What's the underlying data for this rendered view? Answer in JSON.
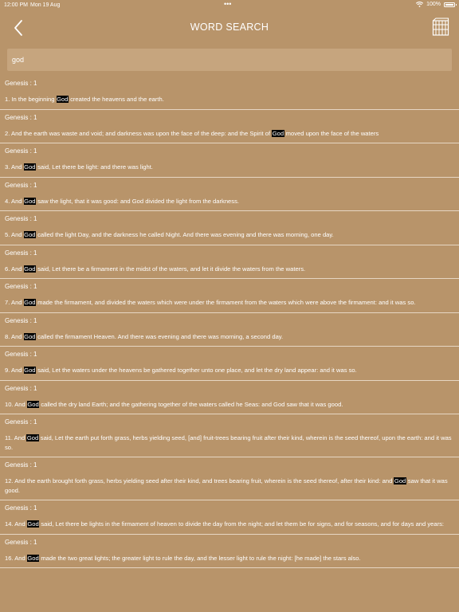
{
  "status_bar": {
    "time": "12:00 PM",
    "date": "Mon 19 Aug",
    "dots": "•••",
    "battery": "100%",
    "battery_level": 1.0
  },
  "nav": {
    "title": "WORD SEARCH",
    "back_icon": "chevron-left-icon",
    "book_icon": "bible-icon"
  },
  "search": {
    "value": "god"
  },
  "results": [
    {
      "ref": "Genesis : 1",
      "before": "1. In the beginning ",
      "word": "God",
      "after": " created the heavens and the earth."
    },
    {
      "ref": "Genesis : 1",
      "before": "2. And the earth was waste and void; and darkness was upon the face of the deep: and the Spirit of ",
      "word": "God",
      "after": " moved upon the face of the waters"
    },
    {
      "ref": "Genesis : 1",
      "before": "3. And ",
      "word": "God",
      "after": " said, Let there be light: and there was light."
    },
    {
      "ref": "Genesis : 1",
      "before": "4. And ",
      "word": "God",
      "after": " saw the light, that it was good: and God divided the light from the darkness."
    },
    {
      "ref": "Genesis : 1",
      "before": "5. And ",
      "word": "God",
      "after": " called the light Day, and the darkness he called Night. And there was evening and there was morning, one day."
    },
    {
      "ref": "Genesis : 1",
      "before": "6. And ",
      "word": "God",
      "after": " said, Let there be a firmament in the midst of the waters, and let it divide the waters from the waters."
    },
    {
      "ref": "Genesis : 1",
      "before": "7. And ",
      "word": "God",
      "after": " made the firmament, and divided the waters which were under the firmament from the waters which were above the firmament: and it was so."
    },
    {
      "ref": "Genesis : 1",
      "before": "8. And ",
      "word": "God",
      "after": " called the firmament Heaven. And there was evening and there was morning, a second day."
    },
    {
      "ref": "Genesis : 1",
      "before": "9. And ",
      "word": "God",
      "after": " said, Let the waters under the heavens be gathered together unto one place, and let the dry land appear: and it was so."
    },
    {
      "ref": "Genesis : 1",
      "before": "10. And ",
      "word": "God",
      "after": " called the dry land Earth; and the gathering together of the waters called he Seas: and God saw that it was good."
    },
    {
      "ref": "Genesis : 1",
      "before": "11. And ",
      "word": "God",
      "after": " said, Let the earth put forth grass, herbs yielding seed, [and] fruit-trees bearing fruit after their kind, wherein is the seed thereof, upon the earth: and it was so."
    },
    {
      "ref": "Genesis : 1",
      "before": "12. And the earth brought forth grass, herbs yielding seed after their kind, and trees bearing fruit, wherein is the seed thereof, after their kind: and ",
      "word": "God",
      "after": " saw that it was good."
    },
    {
      "ref": "Genesis : 1",
      "before": "14. And ",
      "word": "God",
      "after": " said, Let there be lights in the firmament of heaven to divide the day from the night; and let them be for signs, and for seasons, and for days and years:"
    },
    {
      "ref": "Genesis : 1",
      "before": "16. And ",
      "word": "God",
      "after": " made the two great lights; the greater light to rule the day, and the lesser light to rule the night: [he made] the stars also."
    }
  ]
}
